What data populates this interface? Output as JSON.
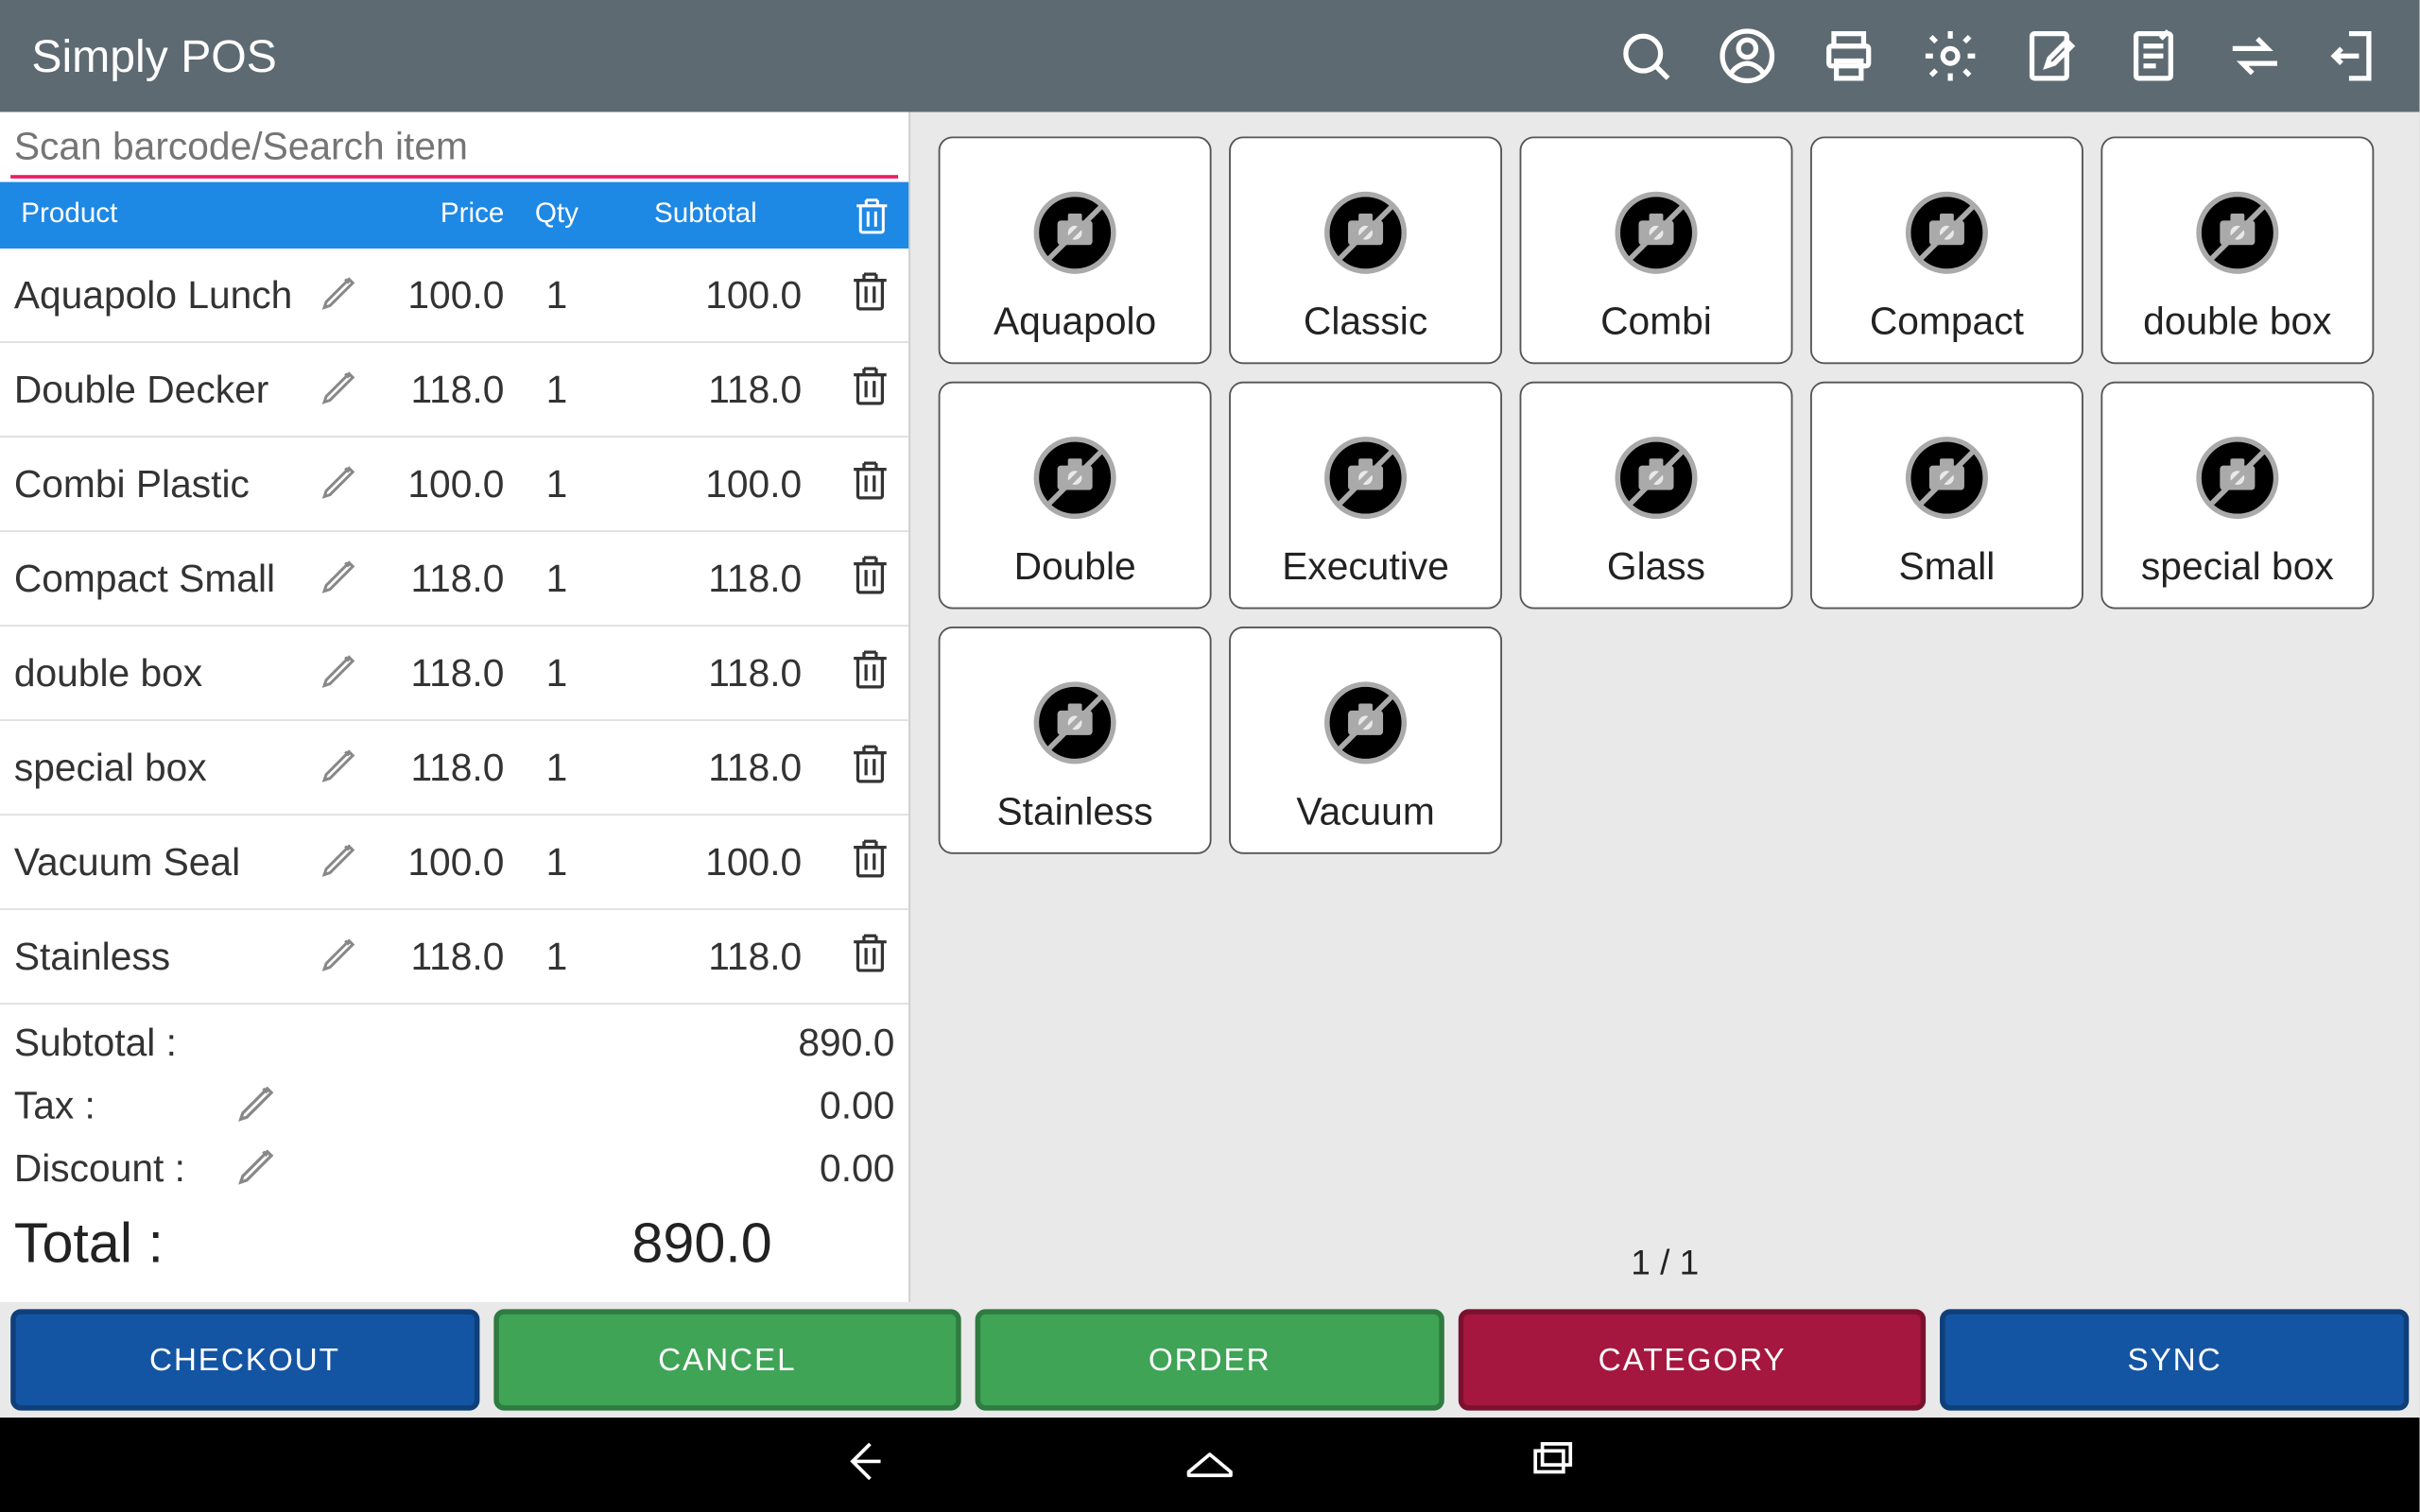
{
  "app_title": "Simply POS",
  "search_placeholder": "Scan barcode/Search item",
  "columns": {
    "product": "Product",
    "price": "Price",
    "qty": "Qty",
    "subtotal": "Subtotal"
  },
  "cart": [
    {
      "name": "Aquapolo Lunch",
      "price": "100.0",
      "qty": "1",
      "subtotal": "100.0"
    },
    {
      "name": "Double Decker",
      "price": "118.0",
      "qty": "1",
      "subtotal": "118.0"
    },
    {
      "name": "Combi Plastic",
      "price": "100.0",
      "qty": "1",
      "subtotal": "100.0"
    },
    {
      "name": "Compact Small",
      "price": "118.0",
      "qty": "1",
      "subtotal": "118.0"
    },
    {
      "name": "double box",
      "price": "118.0",
      "qty": "1",
      "subtotal": "118.0"
    },
    {
      "name": "special box",
      "price": "118.0",
      "qty": "1",
      "subtotal": "118.0"
    },
    {
      "name": "Vacuum Seal",
      "price": "100.0",
      "qty": "1",
      "subtotal": "100.0"
    },
    {
      "name": "Stainless",
      "price": "118.0",
      "qty": "1",
      "subtotal": "118.0"
    }
  ],
  "totals": {
    "subtotal_label": "Subtotal :",
    "subtotal_value": "890.0",
    "tax_label": "Tax :",
    "tax_value": "0.00",
    "discount_label": "Discount :",
    "discount_value": "0.00",
    "total_label": "Total :",
    "total_value": "890.0"
  },
  "products": [
    {
      "label": "Aquapolo"
    },
    {
      "label": "Classic"
    },
    {
      "label": "Combi"
    },
    {
      "label": "Compact"
    },
    {
      "label": "double box"
    },
    {
      "label": "Double"
    },
    {
      "label": "Executive"
    },
    {
      "label": "Glass"
    },
    {
      "label": "Small"
    },
    {
      "label": "special box"
    },
    {
      "label": "Stainless"
    },
    {
      "label": "Vacuum"
    }
  ],
  "pager": "1 / 1",
  "actions": {
    "checkout": "CHECKOUT",
    "cancel": "CANCEL",
    "order": "ORDER",
    "category": "CATEGORY",
    "sync": "SYNC"
  }
}
